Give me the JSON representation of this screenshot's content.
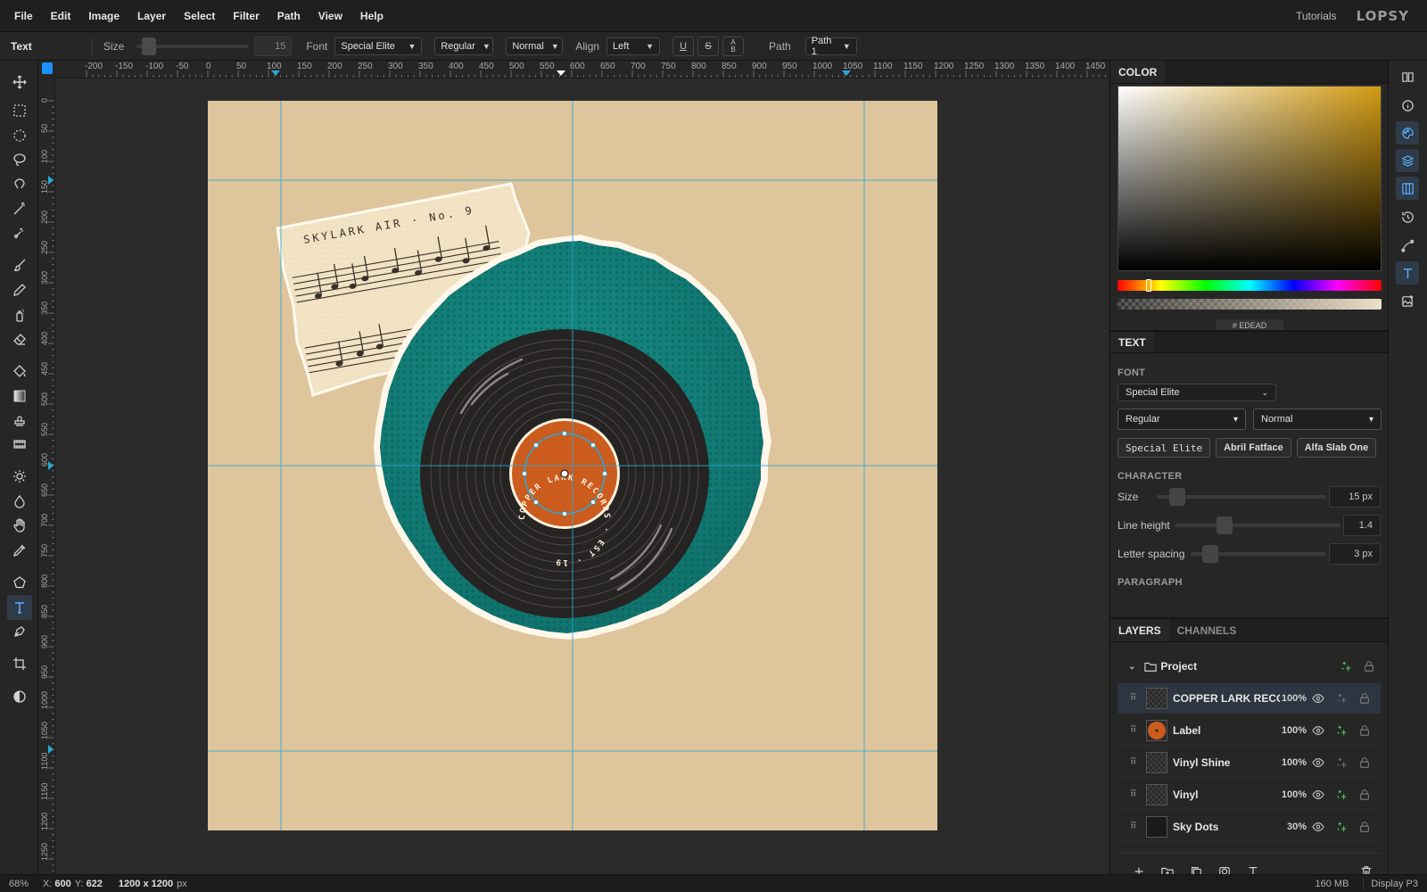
{
  "menu": [
    "File",
    "Edit",
    "Image",
    "Layer",
    "Select",
    "Filter",
    "Path",
    "View",
    "Help"
  ],
  "header": {
    "tutorials": "Tutorials",
    "logo": "LOPSY"
  },
  "options": {
    "tool": "Text",
    "size_label": "Size",
    "size_value": "15",
    "font_label": "Font",
    "font": "Special Elite",
    "weight": "Regular",
    "style": "Normal",
    "align_label": "Align",
    "align": "Left",
    "underline": "U",
    "strike": "S",
    "case_top": "A",
    "case_bottom": "B",
    "path_label": "Path",
    "path": "Path 1"
  },
  "ruler": {
    "top": [
      "-200",
      "-150",
      "-100",
      "-50",
      "0",
      "50",
      "100",
      "150",
      "200",
      "250",
      "300",
      "350",
      "400",
      "450",
      "500",
      "550",
      "600",
      "650",
      "700",
      "750",
      "800",
      "850",
      "900",
      "950",
      "1000",
      "1050",
      "1100",
      "1150",
      "1200",
      "1250",
      "1300",
      "1350",
      "1400",
      "1450"
    ],
    "left": [
      "0",
      "50",
      "100",
      "150",
      "200",
      "250",
      "300",
      "350",
      "400",
      "450",
      "500",
      "550",
      "600",
      "650",
      "700",
      "750",
      "800",
      "850",
      "900",
      "950",
      "1000",
      "1050",
      "1100",
      "1150",
      "1200",
      "1250"
    ]
  },
  "artwork": {
    "note_text": "SKYLARK AIR · No. 9",
    "label_text": "COPPER LARK RECORDS · EST · 19",
    "colors": {
      "paper": "#dec59c",
      "teal": "#127e78",
      "vinyl": "#262423",
      "label": "#cc5b1e",
      "guide": "#2aa8d8"
    }
  },
  "color_panel": {
    "tab": "COLOR",
    "hex_peek": "# EDEAD"
  },
  "text_panel": {
    "tab": "TEXT",
    "font_section": "FONT",
    "font": "Special Elite",
    "weight": "Regular",
    "style": "Normal",
    "presets": [
      "Special Elite",
      "Abril Fatface",
      "Alfa Slab One"
    ],
    "character_section": "CHARACTER",
    "size_label": "Size",
    "size_value": "15 px",
    "size_level": 0.08,
    "line_height_label": "Line height",
    "line_height_value": "1.4",
    "line_height_level": 0.28,
    "letter_spacing_label": "Letter spacing",
    "letter_spacing_value": "3 px",
    "letter_spacing_level": 0.1,
    "paragraph_section": "PARAGRAPH"
  },
  "layers_panel": {
    "tabs": [
      "LAYERS",
      "CHANNELS"
    ],
    "group": "Project",
    "layers": [
      {
        "name": "COPPER LARK RECO",
        "opacity": "100%"
      },
      {
        "name": "Label",
        "opacity": "100%"
      },
      {
        "name": "Vinyl Shine",
        "opacity": "100%"
      },
      {
        "name": "Vinyl",
        "opacity": "100%"
      },
      {
        "name": "Sky Dots",
        "opacity": "30%"
      }
    ]
  },
  "status": {
    "zoom": "68%",
    "x_label": "X:",
    "x": "600",
    "y_label": "Y:",
    "y": "622",
    "doc_size": "1200 x 1200",
    "doc_unit": "px",
    "memory": "160 MB",
    "display": "Display P3"
  }
}
